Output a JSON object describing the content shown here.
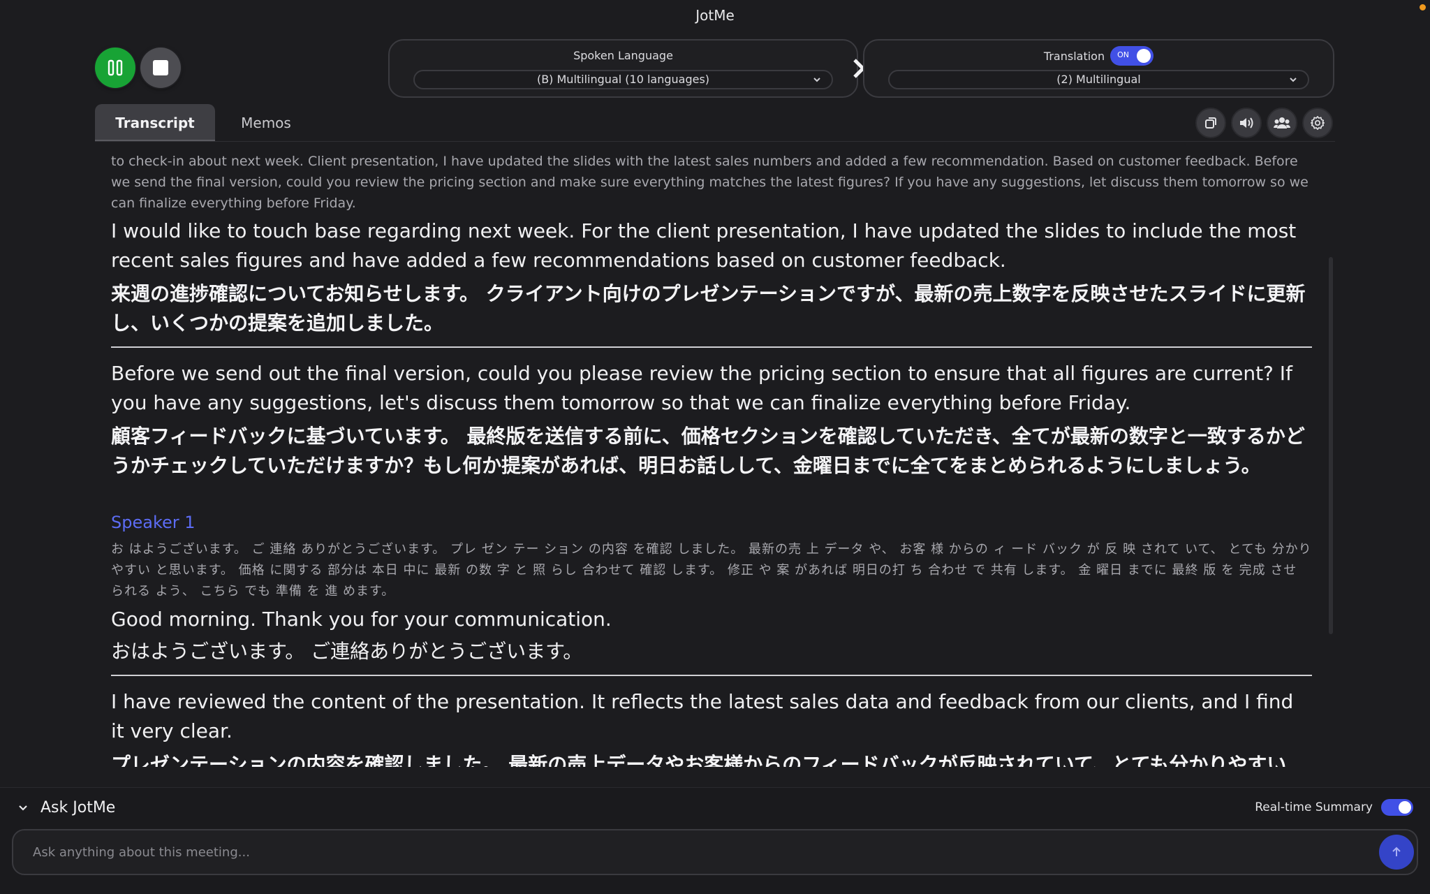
{
  "app": {
    "title": "JotMe"
  },
  "controls": {
    "pause_icon": "pause-icon",
    "stop_icon": "stop-icon"
  },
  "spoken_language": {
    "label": "Spoken Language",
    "selected": "(B) Multilingual (10 languages)"
  },
  "translation": {
    "label": "Translation",
    "toggle_text": "ON",
    "enabled": true,
    "selected": "(2) Multilingual"
  },
  "tabs": [
    {
      "label": "Transcript",
      "active": true
    },
    {
      "label": "Memos",
      "active": false
    }
  ],
  "toolbar_icons": [
    "popout-icon",
    "speaker-icon",
    "people-icon",
    "gear-icon"
  ],
  "transcript": {
    "faded_source": "to check-in about next week. Client presentation, I have updated the slides with the latest sales numbers and added a few recommendation. Based on customer feedback. Before we send the final version, could you review the pricing section and make sure everything matches the latest figures? If you have any suggestions, let discuss them tomorrow so we can finalize everything before Friday.",
    "segments": [
      {
        "en": "I would like to touch base regarding next week. For the client presentation, I have updated the slides to include the most recent sales figures and have added a few recommendations based on customer feedback.",
        "ja": "来週の進捗確認についてお知らせします。 クライアント向けのプレゼンテーションですが、最新の売上数字を反映させたスライドに更新し、いくつかの提案を追加しました。"
      },
      {
        "en": "Before we send out the final version, could you please review the pricing section to ensure that all figures are current? If you have any suggestions, let's discuss them tomorrow so that we can finalize everything before Friday.",
        "ja": "顧客フィードバックに基づいています。 最終版を送信する前に、価格セクションを確認していただき、全てが最新の数字と一致するかどうかチェックしていただけますか？もし何か提案があれば、明日お話しして、金曜日までに全てをまとめられるようにしましょう。"
      }
    ],
    "speaker": {
      "name": "Speaker 1",
      "raw": "お はようございます。 ご 連絡 ありがとうございます。 プレ ゼン テー ション の内容 を確認 しました。 最新の売 上 データ や、 お客 様 からの ィ ード バック が 反 映 されて いて、 とても 分かり やすい と思います。 価格 に関する 部分は 本日 中に 最新 の数 字 と 照 らし 合わせて 確認 します。 修正 や 案 があれば 明日の打 ち 合わせ で 共有 します。 金 曜日 までに 最終 版 を 完成 させ られる よう、 こちら でも 準備 を 進 めます。",
      "segments": [
        {
          "en": "Good morning. Thank you for your communication.",
          "ja": "おはようございます。 ご連絡ありがとうございます。"
        },
        {
          "en": "I have reviewed the content of the presentation. It reflects the latest sales data and feedback from our clients, and I find it very clear.",
          "ja": "プレゼンテーションの内容を確認しました。 最新の売上データやお客様からのフィードバックが反映されていて、とても分かりやすい"
        }
      ]
    }
  },
  "ask": {
    "title": "Ask JotMe",
    "realtime_label": "Real-time Summary",
    "realtime_enabled": true,
    "placeholder": "Ask anything about this meeting..."
  },
  "colors": {
    "accent": "#4150e6",
    "speaker": "#5c6cf4",
    "record_green": "#18a335",
    "background": "#1c1c1f"
  }
}
